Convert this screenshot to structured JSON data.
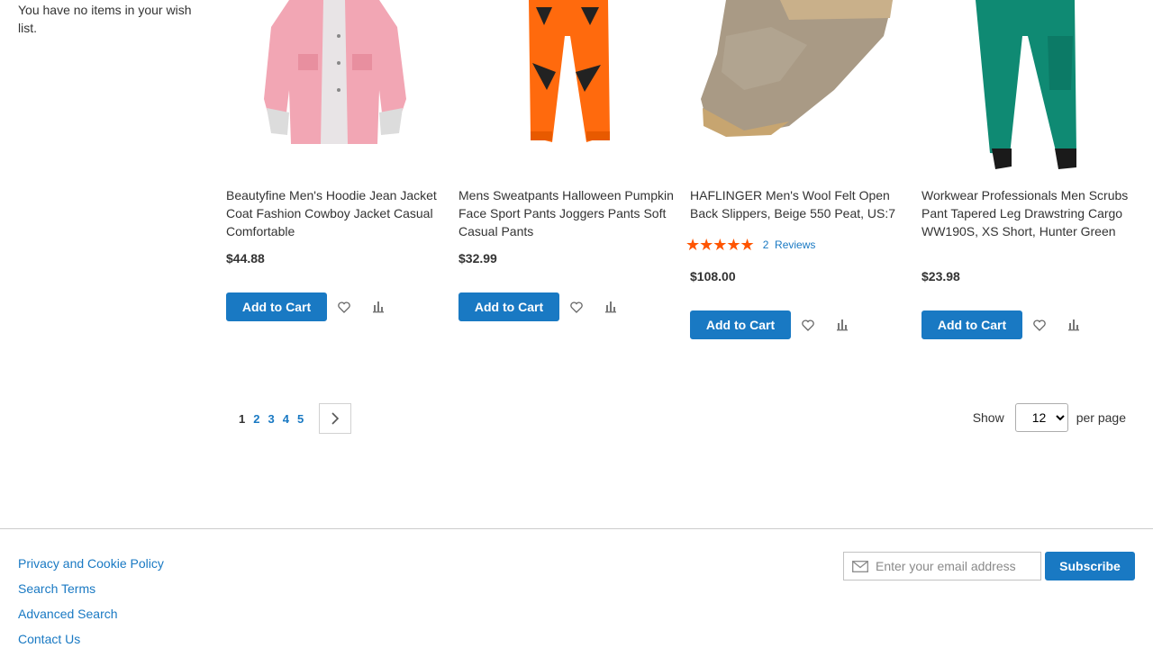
{
  "sidebar": {
    "wishlist_empty": "You have no items in your wish list."
  },
  "products": [
    {
      "name": "Beautyfine Men's Hoodie Jean Jacket Coat Fashion Cowboy Jacket Casual Comfortable",
      "price": "$44.88",
      "add_to_cart": "Add to Cart",
      "image_icon": "pink-jacket"
    },
    {
      "name": "Mens Sweatpants Halloween Pumpkin Face Sport Pants Joggers Pants Soft Casual Pants",
      "price": "$32.99",
      "add_to_cart": "Add to Cart",
      "image_icon": "orange-pumpkin-pants"
    },
    {
      "name": "HAFLINGER Men's Wool Felt Open Back Slippers, Beige 550 Peat, US:7",
      "rating_stars": 5,
      "reviews_count": "2",
      "reviews_label": "Reviews",
      "price": "$108.00",
      "add_to_cart": "Add to Cart",
      "image_icon": "felt-slipper"
    },
    {
      "name": "Workwear Professionals Men Scrubs Pant Tapered Leg Drawstring Cargo WW190S, XS Short, Hunter Green",
      "price": "$23.98",
      "add_to_cart": "Add to Cart",
      "image_icon": "green-scrub-pants"
    }
  ],
  "pager": {
    "pages": [
      "1",
      "2",
      "3",
      "4",
      "5"
    ],
    "current": "1"
  },
  "limiter": {
    "show_label": "Show",
    "selected": "12",
    "per_page_label": "per page"
  },
  "footer": {
    "links": [
      "Privacy and Cookie Policy",
      "Search Terms",
      "Advanced Search",
      "Contact Us"
    ],
    "newsletter_placeholder": "Enter your email address",
    "subscribe_label": "Subscribe"
  },
  "colors": {
    "primary": "#1979c3",
    "rating": "#ff5501"
  }
}
